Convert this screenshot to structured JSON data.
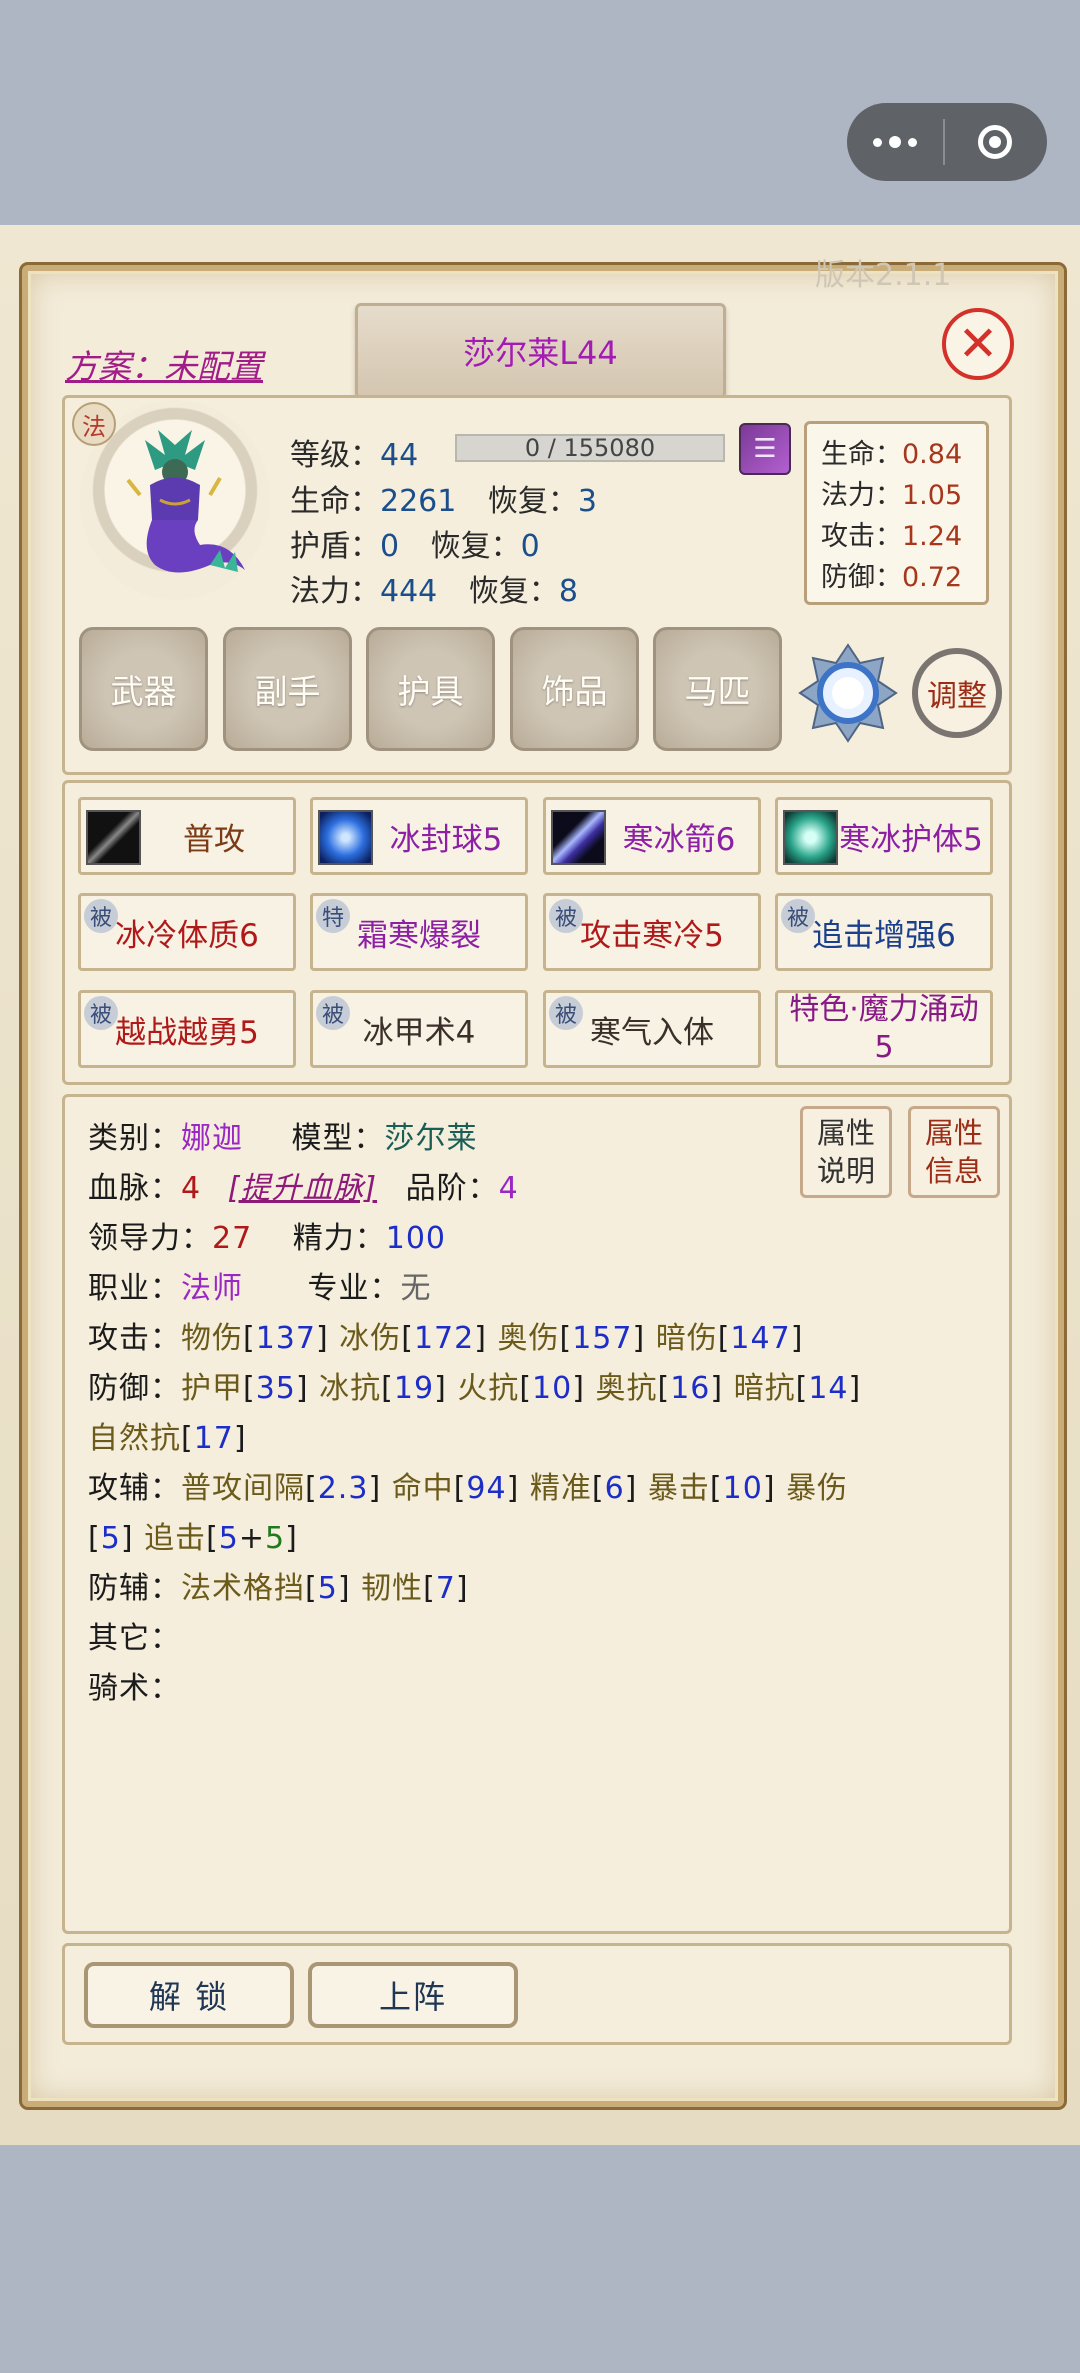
{
  "version_text": "版本2.1.1",
  "plan_label": "方案：未配置",
  "title": "莎尔莱L44",
  "close_glyph": "✕",
  "class_badge": "法",
  "stats": {
    "level_label": "等级：",
    "level": "44",
    "exp": "0 / 155080",
    "hp_label": "生命：",
    "hp": "2261",
    "hp_regen_label": "恢复：",
    "hp_regen": "3",
    "shield_label": "护盾：",
    "shield": "0",
    "shield_regen_label": "恢复：",
    "shield_regen": "0",
    "mana_label": "法力：",
    "mana": "444",
    "mana_regen_label": "恢复：",
    "mana_regen": "8"
  },
  "growth": [
    {
      "label": "生命：",
      "value": "0.84"
    },
    {
      "label": "法力：",
      "value": "1.05"
    },
    {
      "label": "攻击：",
      "value": "1.24"
    },
    {
      "label": "防御：",
      "value": "0.72"
    }
  ],
  "equipment_slots": [
    "武器",
    "副手",
    "护具",
    "饰品",
    "马匹"
  ],
  "adjust_label": "调整",
  "skills": [
    {
      "label": "普攻",
      "icon": "sword-icon",
      "color": "#7b3b17"
    },
    {
      "label": "冰封球5",
      "icon": "ice-orb-icon",
      "color": "#8d1fa5"
    },
    {
      "label": "寒冰箭6",
      "icon": "ice-arrow-icon",
      "color": "#8d1fa5"
    },
    {
      "label": "寒冰护体5",
      "icon": "ice-armor-icon",
      "color": "#8d1fa5"
    },
    {
      "label": "冰冷体质6",
      "tag": "被",
      "color": "#b01919"
    },
    {
      "label": "霜寒爆裂",
      "tag": "特",
      "color": "#8d1fa5"
    },
    {
      "label": "攻击寒冷5",
      "tag": "被",
      "color": "#b01919"
    },
    {
      "label": "追击增强6",
      "tag": "被",
      "color": "#1a3f8c"
    },
    {
      "label": "越战越勇5",
      "tag": "被",
      "color": "#b01919"
    },
    {
      "label": "冰甲术4",
      "tag": "被",
      "color": "#3b2f2a"
    },
    {
      "label": "寒气入体",
      "tag": "被",
      "color": "#3b2f2a"
    },
    {
      "label": "特色·魔力涌动5",
      "color": "#881a86"
    }
  ],
  "details": {
    "category_label": "类别：",
    "category": "娜迦",
    "model_label": "模型：",
    "model": "莎尔莱",
    "bloodline_label": "血脉：",
    "bloodline": "4",
    "upgrade_bloodline": "[提升血脉]",
    "rank_label": "品阶：",
    "rank": "4",
    "leadership_label": "领导力：",
    "leadership": "27",
    "energy_label": "精力：",
    "energy": "100",
    "job_label": "职业：",
    "job": "法师",
    "specialty_label": "专业：",
    "specialty": "无",
    "attack_label": "攻击：",
    "attack": [
      {
        "name": "物伤",
        "value": "137"
      },
      {
        "name": "冰伤",
        "value": "172"
      },
      {
        "name": "奥伤",
        "value": "157"
      },
      {
        "name": "暗伤",
        "value": "147"
      }
    ],
    "defense_label": "防御：",
    "defense": [
      {
        "name": "护甲",
        "value": "35"
      },
      {
        "name": "冰抗",
        "value": "19"
      },
      {
        "name": "火抗",
        "value": "10"
      },
      {
        "name": "奥抗",
        "value": "16"
      },
      {
        "name": "暗抗",
        "value": "14"
      }
    ],
    "nature_res_name": "自然抗",
    "nature_res": "17",
    "attack_aux_label": "攻辅：",
    "attack_aux": [
      {
        "name": "普攻间隔",
        "value": "2.3"
      },
      {
        "name": "命中",
        "value": "94"
      },
      {
        "name": "精准",
        "value": "6"
      },
      {
        "name": "暴击",
        "value": "10"
      }
    ],
    "crit_dmg_name": "暴伤",
    "crit_dmg": "5",
    "pursuit_name": "追击",
    "pursuit_base": "5",
    "pursuit_bonus": "5",
    "defense_aux_label": "防辅：",
    "defense_aux": [
      {
        "name": "法术格挡",
        "value": "5"
      },
      {
        "name": "韧性",
        "value": "7"
      }
    ],
    "other_label": "其它：",
    "riding_label": "骑术："
  },
  "attr_buttons": {
    "explain": "属性\n说明",
    "info": "属性\n信息"
  },
  "actions": {
    "unlock": "解 锁",
    "deploy": "上阵"
  }
}
